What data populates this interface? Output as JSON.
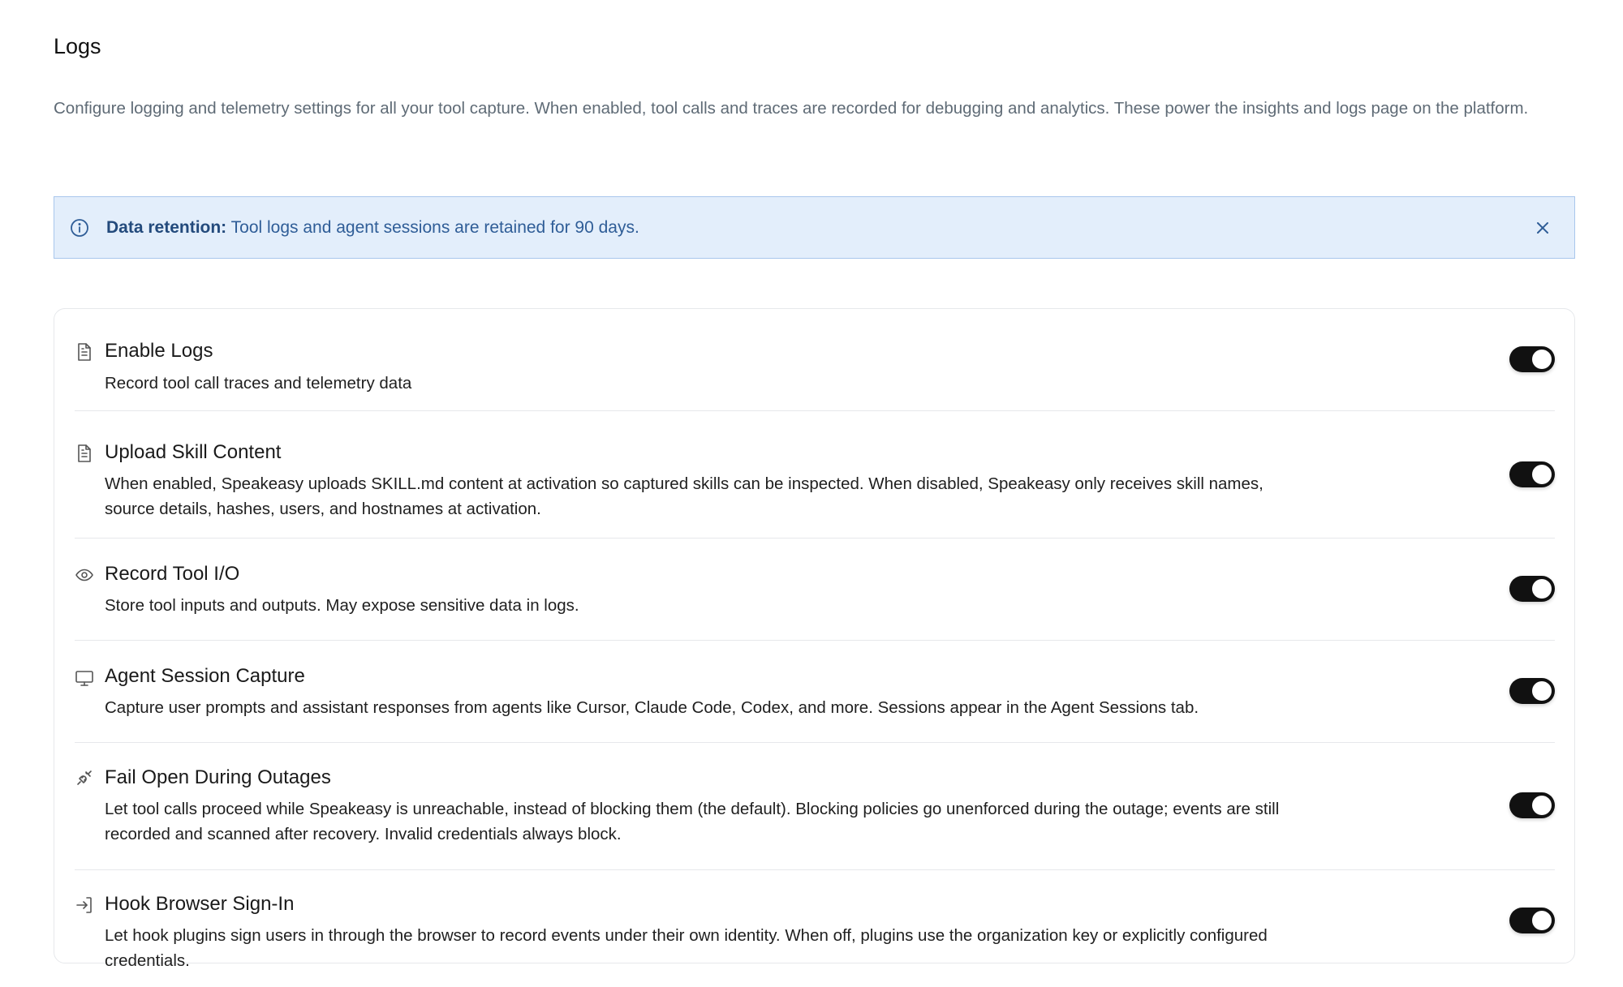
{
  "page": {
    "title": "Logs",
    "description": "Configure logging and telemetry settings for all your tool capture. When enabled, tool calls and traces are recorded for debugging and analytics. These power the insights and logs page on the platform."
  },
  "banner": {
    "icon": "info-icon",
    "label": "Data retention:",
    "text": " Tool logs and agent sessions are retained for 90 days.",
    "close_icon": "close-icon"
  },
  "settings": [
    {
      "icon": "document-icon",
      "title": "Enable Logs",
      "description": "Record tool call traces and telemetry data",
      "enabled": true
    },
    {
      "icon": "document-icon",
      "title": "Upload Skill Content",
      "description": "When enabled, Speakeasy uploads SKILL.md content at activation so captured skills can be inspected. When disabled, Speakeasy only receives skill names, source details, hashes, users, and hostnames at activation.",
      "enabled": true
    },
    {
      "icon": "eye-icon",
      "title": "Record Tool I/O",
      "description": "Store tool inputs and outputs. May expose sensitive data in logs.",
      "enabled": true
    },
    {
      "icon": "monitor-icon",
      "title": "Agent Session Capture",
      "description": "Capture user prompts and assistant responses from agents like Cursor, Claude Code, Codex, and more. Sessions appear in the Agent Sessions tab.",
      "enabled": true
    },
    {
      "icon": "unplug-icon",
      "title": "Fail Open During Outages",
      "description": "Let tool calls proceed while Speakeasy is unreachable, instead of blocking them (the default). Blocking policies go unenforced during the outage; events are still recorded and scanned after recovery. Invalid credentials always block.",
      "enabled": true
    },
    {
      "icon": "sign-in-icon",
      "title": "Hook Browser Sign-In",
      "description": "Let hook plugins sign users in through the browser to record events under their own identity. When off, plugins use the organization key or explicitly configured credentials.",
      "enabled": true
    }
  ]
}
